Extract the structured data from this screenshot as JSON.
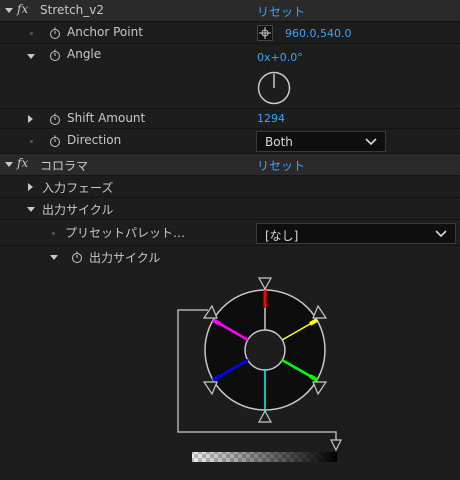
{
  "effects": [
    {
      "name": "Stretch_v2",
      "reset": "リセット"
    },
    {
      "name": "コロラマ",
      "reset": "リセット"
    }
  ],
  "stretch": {
    "anchor_point": {
      "label": "Anchor Point",
      "value": "960.0,540.0"
    },
    "angle": {
      "label": "Angle",
      "value": "0x+0.0°",
      "degrees": 0
    },
    "shift_amount": {
      "label": "Shift Amount",
      "value": "1294"
    },
    "direction": {
      "label": "Direction",
      "value": "Both"
    }
  },
  "colorama": {
    "input_phase": "入力フェーズ",
    "output_cycle_group": "出力サイクル",
    "preset_palette": {
      "label": "プリセットパレット…",
      "value": "[なし]"
    },
    "output_cycle_prop": "出力サイクル",
    "wheel_colors": [
      "#ff0000",
      "#ffff00",
      "#00ff00",
      "#00ffff",
      "#0000ff",
      "#ff00ff"
    ]
  }
}
